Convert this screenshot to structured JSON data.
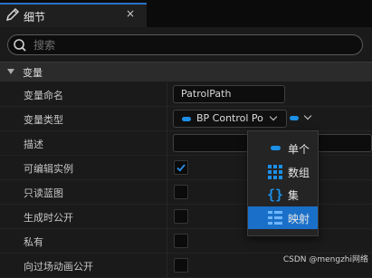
{
  "tab": {
    "title": "细节",
    "close": "×",
    "icon": "pencil-icon"
  },
  "search": {
    "placeholder": "搜索"
  },
  "category": {
    "label": "变量"
  },
  "properties": {
    "name": {
      "label": "变量命名",
      "value": "PatrolPath"
    },
    "type": {
      "label": "变量类型",
      "value": "BP Control Po",
      "pill_color": "#1c8fe6"
    },
    "description": {
      "label": "描述",
      "value": ""
    },
    "instance_editable": {
      "label": "可编辑实例",
      "checked": true
    },
    "blueprint_readonly": {
      "label": "只读蓝图",
      "checked": false
    },
    "expose_on_spawn": {
      "label": "生成时公开",
      "checked": false
    },
    "private": {
      "label": "私有",
      "checked": false
    },
    "expose_to_cinematics": {
      "label": "向过场动画公开",
      "checked": false
    }
  },
  "container_menu": {
    "items": [
      {
        "label": "单个",
        "icon": "single-pill-icon",
        "selected": false
      },
      {
        "label": "数组",
        "icon": "array-grid-icon",
        "selected": false
      },
      {
        "label": "集",
        "icon": "set-braces-icon",
        "selected": false
      },
      {
        "label": "映射",
        "icon": "map-grid-icon",
        "selected": true
      }
    ]
  },
  "colors": {
    "accent": "#1c8fe6",
    "selection": "#1a70c8",
    "tab_underline": "#2a72c8"
  },
  "watermark": "CSDN @mengzhi网络"
}
